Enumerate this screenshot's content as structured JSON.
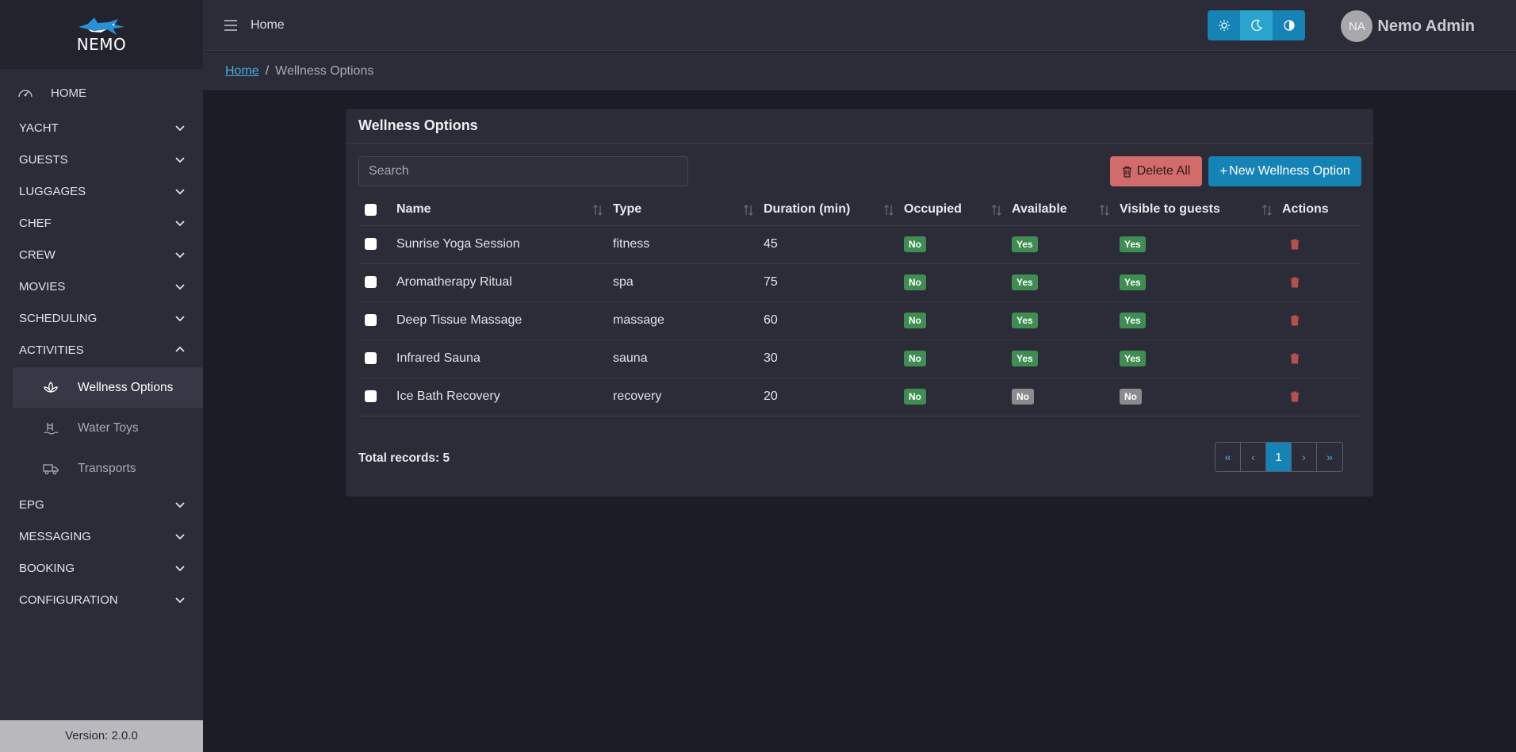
{
  "app": {
    "logo_text": "NEMO",
    "version": "Version: 2.0.0"
  },
  "sidebar": {
    "home": "HOME",
    "items": [
      {
        "label": "YACHT"
      },
      {
        "label": "GUESTS"
      },
      {
        "label": "LUGGAGES"
      },
      {
        "label": "CHEF"
      },
      {
        "label": "CREW"
      },
      {
        "label": "MOVIES"
      },
      {
        "label": "SCHEDULING"
      },
      {
        "label": "ACTIVITIES"
      }
    ],
    "activities_sub": [
      {
        "label": "Wellness Options",
        "icon": "lotus-icon",
        "active": true
      },
      {
        "label": "Water Toys",
        "icon": "pool-ladder-icon"
      },
      {
        "label": "Transports",
        "icon": "truck-icon"
      }
    ],
    "items_after": [
      {
        "label": "EPG"
      },
      {
        "label": "MESSAGING"
      },
      {
        "label": "BOOKING"
      },
      {
        "label": "CONFIGURATION"
      }
    ]
  },
  "topbar": {
    "title": "Home",
    "user_initials": "NA",
    "user_name": "Nemo Admin"
  },
  "breadcrumb": {
    "home": "Home",
    "separator": "/",
    "current": "Wellness Options"
  },
  "card": {
    "title": "Wellness Options",
    "search_placeholder": "Search",
    "delete_all": "Delete All",
    "new_button": "New Wellness Option",
    "columns": [
      "Name",
      "Type",
      "Duration (min)",
      "Occupied",
      "Available",
      "Visible to guests",
      "Actions"
    ],
    "rows": [
      {
        "name": "Sunrise Yoga Session",
        "type": "fitness",
        "duration": "45",
        "occupied": "No",
        "available": "Yes",
        "visible": "Yes"
      },
      {
        "name": "Aromatherapy Ritual",
        "type": "spa",
        "duration": "75",
        "occupied": "No",
        "available": "Yes",
        "visible": "Yes"
      },
      {
        "name": "Deep Tissue Massage",
        "type": "massage",
        "duration": "60",
        "occupied": "No",
        "available": "Yes",
        "visible": "Yes"
      },
      {
        "name": "Infrared Sauna",
        "type": "sauna",
        "duration": "30",
        "occupied": "No",
        "available": "Yes",
        "visible": "Yes"
      },
      {
        "name": "Ice Bath Recovery",
        "type": "recovery",
        "duration": "20",
        "occupied": "No",
        "available": "No",
        "visible": "No"
      }
    ],
    "total": "Total records: 5",
    "pager": {
      "first": "«",
      "prev": "‹",
      "page": "1",
      "next": "›",
      "last": "»"
    }
  },
  "colors": {
    "accent": "#1683b7",
    "danger": "#d26b6b",
    "badge_yes": "#3f8d52",
    "badge_no_grey": "#8a8a8f"
  }
}
